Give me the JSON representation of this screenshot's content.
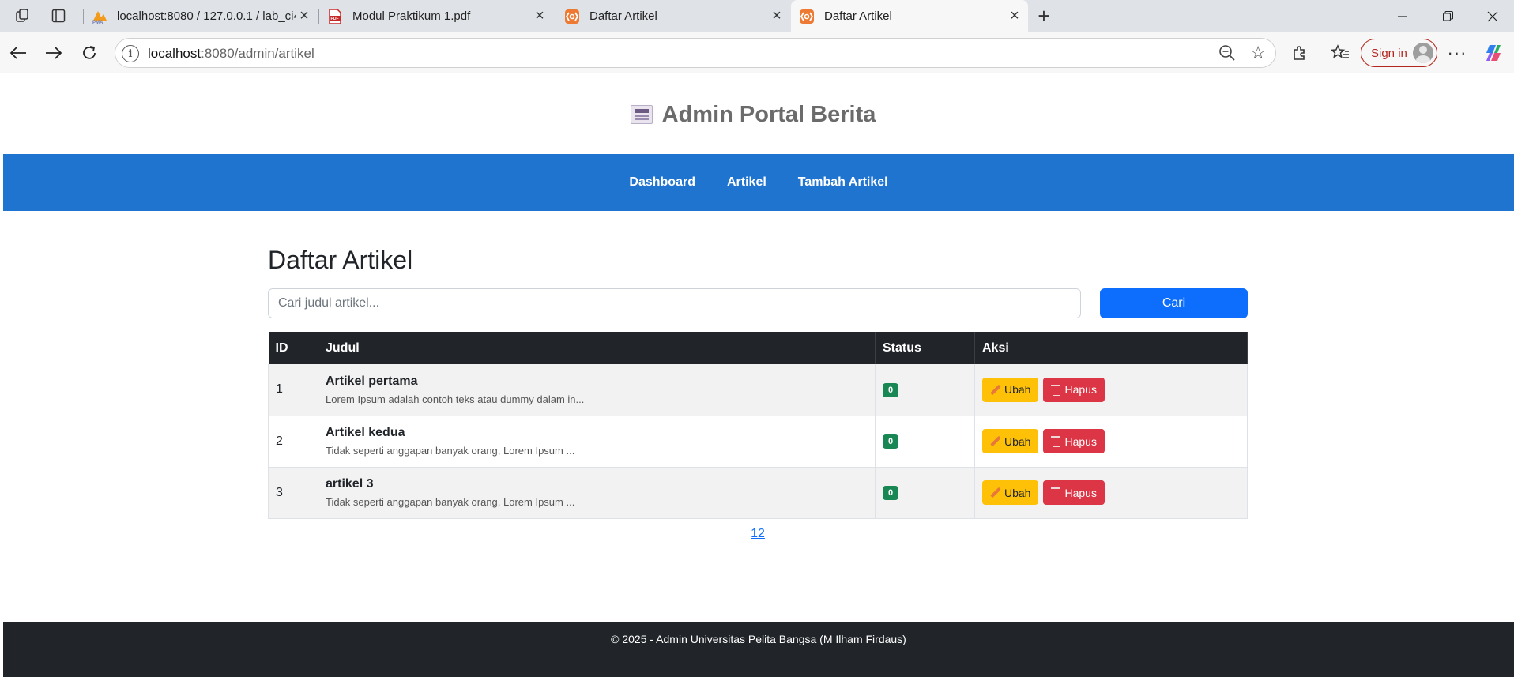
{
  "browser": {
    "tabs": [
      {
        "title": "localhost:8080 / 127.0.0.1 / lab_ci4",
        "favicon": "phpmyadmin-icon",
        "active": false
      },
      {
        "title": "Modul Praktikum 1.pdf",
        "favicon": "pdf-icon",
        "active": false
      },
      {
        "title": "Daftar Artikel",
        "favicon": "codeigniter-icon",
        "active": false
      },
      {
        "title": "Daftar Artikel",
        "favicon": "codeigniter-icon",
        "active": true
      }
    ],
    "url_host": "localhost",
    "url_path": ":8080/admin/artikel",
    "signin_label": "Sign in"
  },
  "site": {
    "brand_title": "Admin Portal Berita",
    "brand_icon": "newspaper-icon",
    "nav": [
      "Dashboard",
      "Artikel",
      "Tambah Artikel"
    ],
    "colors": {
      "navbar": "#1f74d0",
      "primary": "#0d6efd",
      "footer": "#212529"
    }
  },
  "main": {
    "page_title": "Daftar Artikel",
    "search_placeholder": "Cari judul artikel...",
    "search_value": "",
    "search_button": "Cari",
    "table": {
      "headers": [
        "ID",
        "Judul",
        "Status",
        "Aksi"
      ],
      "rows": [
        {
          "id": "1",
          "title": "Artikel pertama",
          "excerpt": "Lorem Ipsum adalah contoh teks atau dummy dalam in...",
          "status": "0",
          "edit": "Ubah",
          "delete": "Hapus"
        },
        {
          "id": "2",
          "title": "Artikel kedua",
          "excerpt": "Tidak seperti anggapan banyak orang, Lorem Ipsum ...",
          "status": "0",
          "edit": "Ubah",
          "delete": "Hapus"
        },
        {
          "id": "3",
          "title": "artikel 3",
          "excerpt": "Tidak seperti anggapan banyak orang, Lorem Ipsum ...",
          "status": "0",
          "edit": "Ubah",
          "delete": "Hapus"
        }
      ]
    },
    "pagination": [
      "1",
      "2"
    ]
  },
  "footer": {
    "text": "© 2025 - Admin Universitas Pelita Bangsa (M Ilham Firdaus)"
  }
}
